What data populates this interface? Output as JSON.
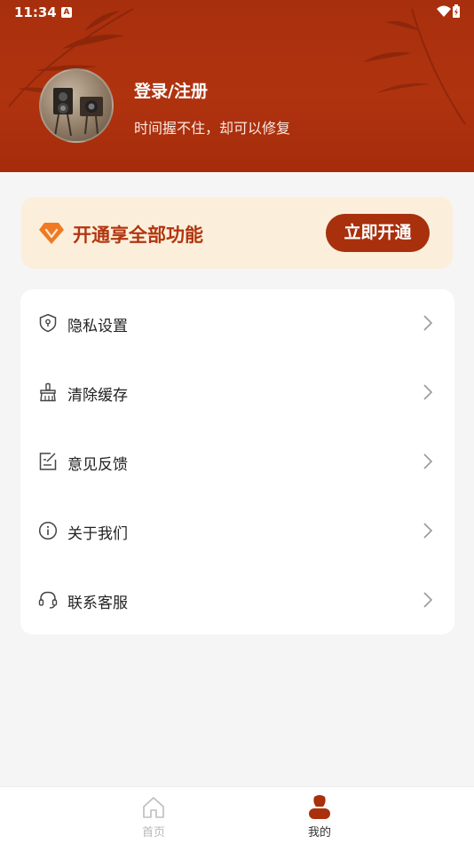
{
  "status_bar": {
    "time": "11:34",
    "notification_icon": "a-icon",
    "wifi_icon": "wifi-icon",
    "battery_icon": "battery-charging-icon"
  },
  "profile": {
    "login_label": "登录/注册",
    "slogan": "时间握不住，却可以修复",
    "avatar_icon": "camera-avatar"
  },
  "vip": {
    "text": "开通享全部功能",
    "button_label": "立即开通",
    "icon": "diamond-icon"
  },
  "menu": {
    "items": [
      {
        "label": "隐私设置",
        "icon": "shield-icon"
      },
      {
        "label": "清除缓存",
        "icon": "broom-icon"
      },
      {
        "label": "意见反馈",
        "icon": "feedback-icon"
      },
      {
        "label": "关于我们",
        "icon": "info-icon"
      },
      {
        "label": "联系客服",
        "icon": "headset-icon"
      }
    ]
  },
  "bottom_nav": {
    "home_label": "首页",
    "mine_label": "我的"
  },
  "colors": {
    "header_bg": "#a82f0d",
    "accent": "#b2360f",
    "vip_card_bg": "#fbefdc",
    "page_bg": "#f5f5f5"
  }
}
